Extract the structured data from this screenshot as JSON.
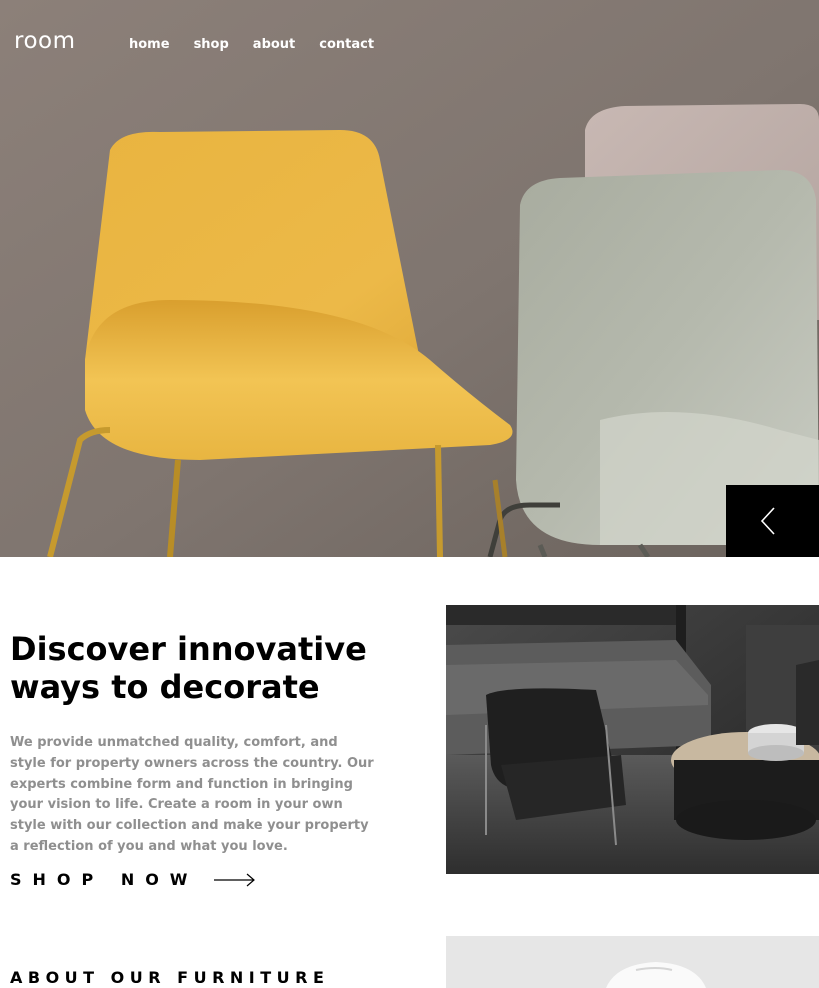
{
  "brand": {
    "logo_text": "room"
  },
  "nav": {
    "items": [
      {
        "label": "home"
      },
      {
        "label": "shop"
      },
      {
        "label": "about"
      },
      {
        "label": "contact"
      }
    ]
  },
  "hero": {
    "image_subject": "yellow and grey chairs",
    "prev_button_icon": "chevron-left-icon"
  },
  "discover": {
    "title": "Discover innovative ways to decorate",
    "body": "We provide unmatched quality, comfort, and style for property owners across the country. Our experts combine form and function in bringing your vision to life. Create a room in your own style with our collection and make your property a reflection of you and what you love.",
    "cta_label": "SHOP NOW",
    "cta_icon": "arrow-right-icon",
    "image_subject": "dark living room furniture"
  },
  "about": {
    "heading": "ABOUT OUR FURNITURE",
    "image_subject": "white chair"
  },
  "colors": {
    "accent_dark": "#000000",
    "text_muted": "#8f8f8f",
    "chair_yellow": "#e8b43e",
    "chair_grey": "#b9bdb4"
  }
}
